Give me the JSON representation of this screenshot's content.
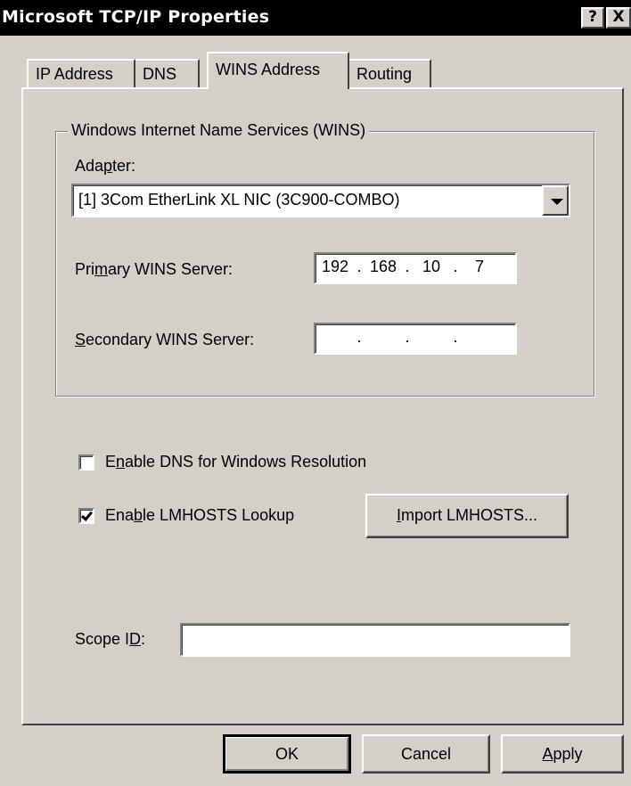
{
  "window": {
    "title": "Microsoft TCP/IP Properties",
    "help_button": "?",
    "close_button": "X"
  },
  "tabs": [
    {
      "label": "IP Address"
    },
    {
      "label": "DNS"
    },
    {
      "label": "WINS Address",
      "selected": true
    },
    {
      "label": "Routing"
    }
  ],
  "wins": {
    "group_title": "Windows Internet Name Services (WINS)",
    "adapter_label_pre": "Ada",
    "adapter_label_accel": "p",
    "adapter_label_post": "ter:",
    "adapter_value": "[1] 3Com EtherLink XL NIC (3C900-COMBO)",
    "primary_label_pre": "Pri",
    "primary_label_accel": "m",
    "primary_label_post": "ary WINS Server:",
    "primary_ip": [
      "192",
      "168",
      "10",
      "7"
    ],
    "secondary_label_accel": "S",
    "secondary_label_post": "econdary WINS Server:",
    "secondary_ip": [
      "",
      "",
      "",
      ""
    ],
    "dot": "."
  },
  "options": {
    "enable_dns_pre": "E",
    "enable_dns_accel": "n",
    "enable_dns_post": "able DNS for Windows Resolution",
    "enable_dns_checked": false,
    "enable_lmhosts_pre": "Ena",
    "enable_lmhosts_accel": "b",
    "enable_lmhosts_post": "le LMHOSTS Lookup",
    "enable_lmhosts_checked": true,
    "import_accel": "I",
    "import_post": "mport LMHOSTS..."
  },
  "scope": {
    "label_pre": "Scope I",
    "label_accel": "D",
    "label_post": ":",
    "value": ""
  },
  "buttons": {
    "ok": "OK",
    "cancel": "Cancel",
    "apply_accel": "A",
    "apply_post": "pply"
  }
}
